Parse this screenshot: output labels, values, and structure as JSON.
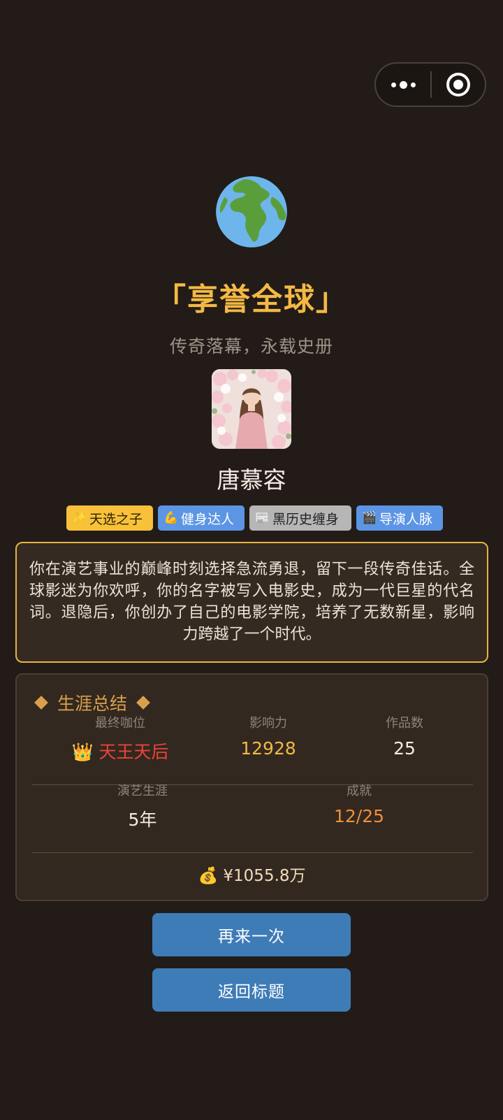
{
  "ending": {
    "title": "「享誉全球」",
    "subtitle": "传奇落幕，永载史册"
  },
  "profile": {
    "name": "唐慕容"
  },
  "tags": [
    {
      "icon": "✨",
      "label": "天选之子"
    },
    {
      "icon": "💪",
      "label": "健身达人"
    },
    {
      "icon": "📰",
      "label": "黑历史缠身"
    },
    {
      "icon": "🎬",
      "label": "导演人脉"
    }
  ],
  "story": "你在演艺事业的巅峰时刻选择急流勇退，留下一段传奇佳话。全球影迷为你欢呼，你的名字被写入电影史，成为一代巨星的代名词。退隐后，你创办了自己的电影学院，培养了无数新星，影响力跨越了一个时代。",
  "summary": {
    "heading": "生涯总结",
    "rank_label": "最终咖位",
    "rank_icon": "👑",
    "rank_value": "天王天后",
    "influence_label": "影响力",
    "influence_value": "12928",
    "works_label": "作品数",
    "works_value": "25",
    "career_label": "演艺生涯",
    "career_value": "5年",
    "achievement_label": "成就",
    "achievement_value": "12/25",
    "money_icon": "💰",
    "money_value": "¥1055.8万"
  },
  "buttons": {
    "retry": "再来一次",
    "back": "返回标题"
  },
  "colors": {
    "background": "#221b17",
    "title_gold": "#f3b944",
    "rank_red": "#e9443a",
    "influence_gold": "#f3b944",
    "achievement_orange": "#ef8f3a",
    "button_blue": "#3e7cb7"
  }
}
